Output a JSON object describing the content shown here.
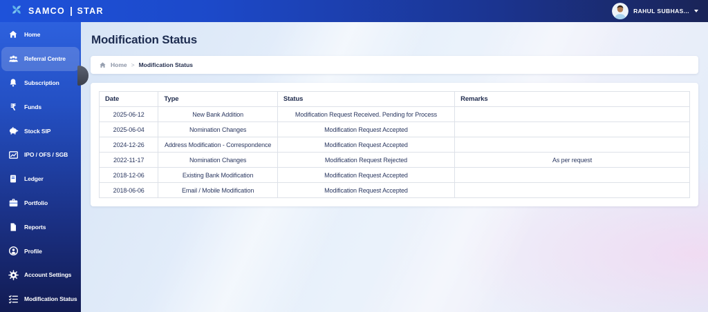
{
  "topbar": {
    "brand_name": "SAMCO",
    "brand_product": "STAR",
    "user_name": "RAHUL SUBHAS...",
    "logo_icon": "samco-pinwheel-icon",
    "user_icons": [
      "avatar",
      "chevron-down-icon"
    ]
  },
  "sidebar": {
    "items": [
      {
        "label": "Home",
        "icon": "home-icon",
        "active": false
      },
      {
        "label": "Referral Centre",
        "icon": "referral-icon",
        "active": true
      },
      {
        "label": "Subscription",
        "icon": "bell-icon",
        "active": false
      },
      {
        "label": "Funds",
        "icon": "rupee-icon",
        "active": false
      },
      {
        "label": "Stock SIP",
        "icon": "piggy-bank-icon",
        "active": false
      },
      {
        "label": "IPO / OFS / SGB",
        "icon": "chart-icon",
        "active": false
      },
      {
        "label": "Ledger",
        "icon": "ledger-icon",
        "active": false
      },
      {
        "label": "Portfolio",
        "icon": "briefcase-icon",
        "active": false
      },
      {
        "label": "Reports",
        "icon": "document-icon",
        "active": false
      },
      {
        "label": "Profile",
        "icon": "person-icon",
        "active": false
      },
      {
        "label": "Account Settings",
        "icon": "gear-icon",
        "active": false
      },
      {
        "label": "Modification Status",
        "icon": "checklist-icon",
        "active": false
      }
    ]
  },
  "main": {
    "page_title": "Modification Status",
    "breadcrumb": {
      "home": "Home",
      "separator": ">",
      "current": "Modification Status",
      "home_icon": "home-icon"
    },
    "table": {
      "headers": [
        "Date",
        "Type",
        "Status",
        "Remarks"
      ],
      "rows": [
        [
          "2025-06-12",
          "New Bank Addition",
          "Modification Request Received. Pending for Process",
          ""
        ],
        [
          "2025-06-04",
          "Nomination Changes",
          "Modification Request Accepted",
          ""
        ],
        [
          "2024-12-26",
          "Address Modification - Correspondence",
          "Modification Request Accepted",
          ""
        ],
        [
          "2022-11-17",
          "Nomination Changes",
          "Modification Request Rejected",
          "As per request"
        ],
        [
          "2018-12-06",
          "Existing Bank Modification",
          "Modification Request Accepted",
          ""
        ],
        [
          "2018-06-06",
          "Email / Mobile Modification",
          "Modification Request Accepted",
          ""
        ]
      ]
    }
  },
  "colors": {
    "topbar_left": "#1e52da",
    "topbar_right": "#1a2457",
    "sidebar_top": "#2d61de",
    "sidebar_bottom": "#121b52",
    "active_item_bg": "rgba(255,255,255,0.18)",
    "card_bg": "#ffffff",
    "table_border": "#dde1e8",
    "text_dark": "#1f2b4d",
    "content_bg": "#e3edfa"
  }
}
